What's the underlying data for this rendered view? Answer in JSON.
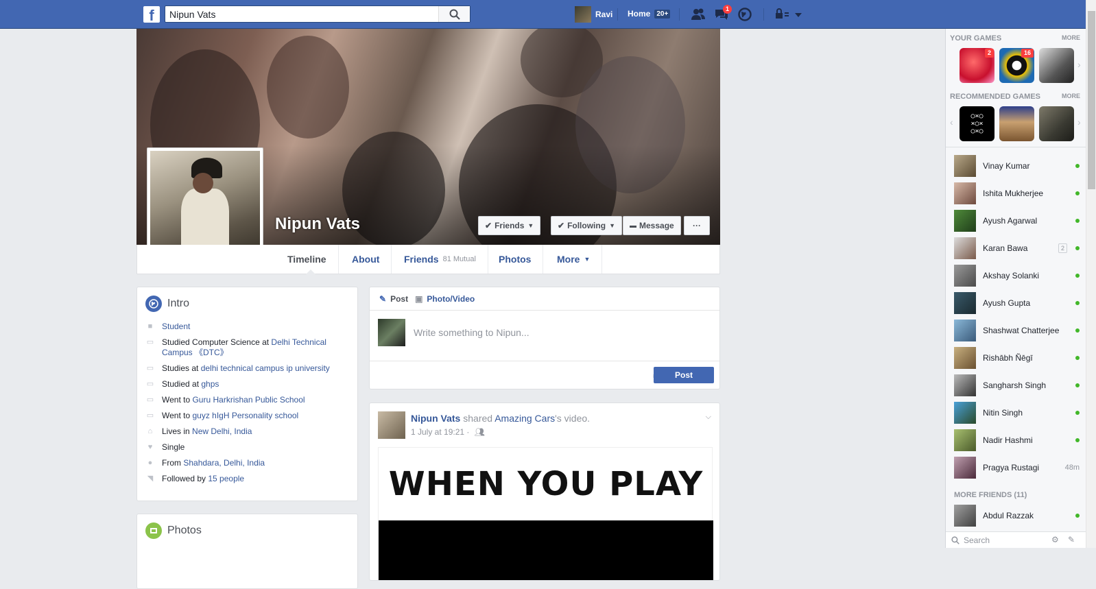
{
  "topbar": {
    "logo": "f",
    "search_value": "Nipun Vats",
    "user_name": "Ravi",
    "home_label": "Home",
    "home_badge": "20+",
    "messages_badge": "1"
  },
  "profile": {
    "name": "Nipun Vats",
    "buttons": {
      "friends": "Friends",
      "following": "Following",
      "message": "Message",
      "more": "···"
    }
  },
  "tabs": [
    {
      "label": "Timeline"
    },
    {
      "label": "About"
    },
    {
      "label": "Friends",
      "extra": "81 Mutual"
    },
    {
      "label": "Photos"
    },
    {
      "label": "More"
    }
  ],
  "intro": {
    "title": "Intro",
    "items": [
      {
        "icon": "briefcase-icon",
        "text": "",
        "link": "Student"
      },
      {
        "icon": "education-icon",
        "text": "Studied Computer Science at ",
        "link": "Delhi Technical Campus 《DTC》"
      },
      {
        "icon": "education-icon",
        "text": "Studies at ",
        "link": "delhi technical campus ip university"
      },
      {
        "icon": "education-icon",
        "text": "Studied at ",
        "link": "ghps"
      },
      {
        "icon": "education-icon",
        "text": "Went to ",
        "link": "Guru Harkrishan Public School"
      },
      {
        "icon": "education-icon",
        "text": "Went to ",
        "link": "guyz hIgH Personality school"
      },
      {
        "icon": "home-icon",
        "text": "Lives in ",
        "link": "New Delhi, India"
      },
      {
        "icon": "heart-icon",
        "text": "Single",
        "link": ""
      },
      {
        "icon": "pin-icon",
        "text": "From ",
        "link": "Shahdara, Delhi, India"
      },
      {
        "icon": "rss-icon",
        "text": "Followed by ",
        "link": "15 people"
      }
    ]
  },
  "photos_card": {
    "title": "Photos"
  },
  "composer": {
    "tab_post": "Post",
    "tab_photo": "Photo/Video",
    "placeholder": "Write something to Nipun...",
    "post_button": "Post"
  },
  "post": {
    "author": "Nipun Vats",
    "action_pre": "shared",
    "page": "Amazing Cars",
    "action_post": "'s video.",
    "time": "1 July at 19:21 ·",
    "media_text": "WHEN YOU PLAY"
  },
  "sidebar": {
    "your_games": "YOUR GAMES",
    "recommended_games": "RECOMMENDED GAMES",
    "more": "MORE",
    "game_badges": [
      "2",
      "16"
    ],
    "contacts": [
      {
        "name": "Vinay Kumar",
        "status": "online"
      },
      {
        "name": "Ishita Mukherjee",
        "status": "online"
      },
      {
        "name": "Ayush Agarwal",
        "status": "online"
      },
      {
        "name": "Karan Bawa",
        "status": "online",
        "badge": "2"
      },
      {
        "name": "Akshay Solanki",
        "status": "online"
      },
      {
        "name": "Ayush Gupta",
        "status": "online"
      },
      {
        "name": "Shashwat Chatterjee",
        "status": "online"
      },
      {
        "name": "Rishābh Ñēgī",
        "status": "online"
      },
      {
        "name": "Sangharsh Singh",
        "status": "online"
      },
      {
        "name": "Nitin Singh",
        "status": "online"
      },
      {
        "name": "Nadir Hashmi",
        "status": "online"
      },
      {
        "name": "Pragya Rustagi",
        "status": "48m"
      }
    ],
    "more_friends": "MORE FRIENDS (11)",
    "more_friends_contacts": [
      {
        "name": "Abdul Razzak",
        "status": "online"
      }
    ],
    "search_placeholder": "Search"
  },
  "colors": {
    "brand": "#4267b2",
    "link": "#365899",
    "online": "#42b72a",
    "notification": "#fa3e3e"
  }
}
